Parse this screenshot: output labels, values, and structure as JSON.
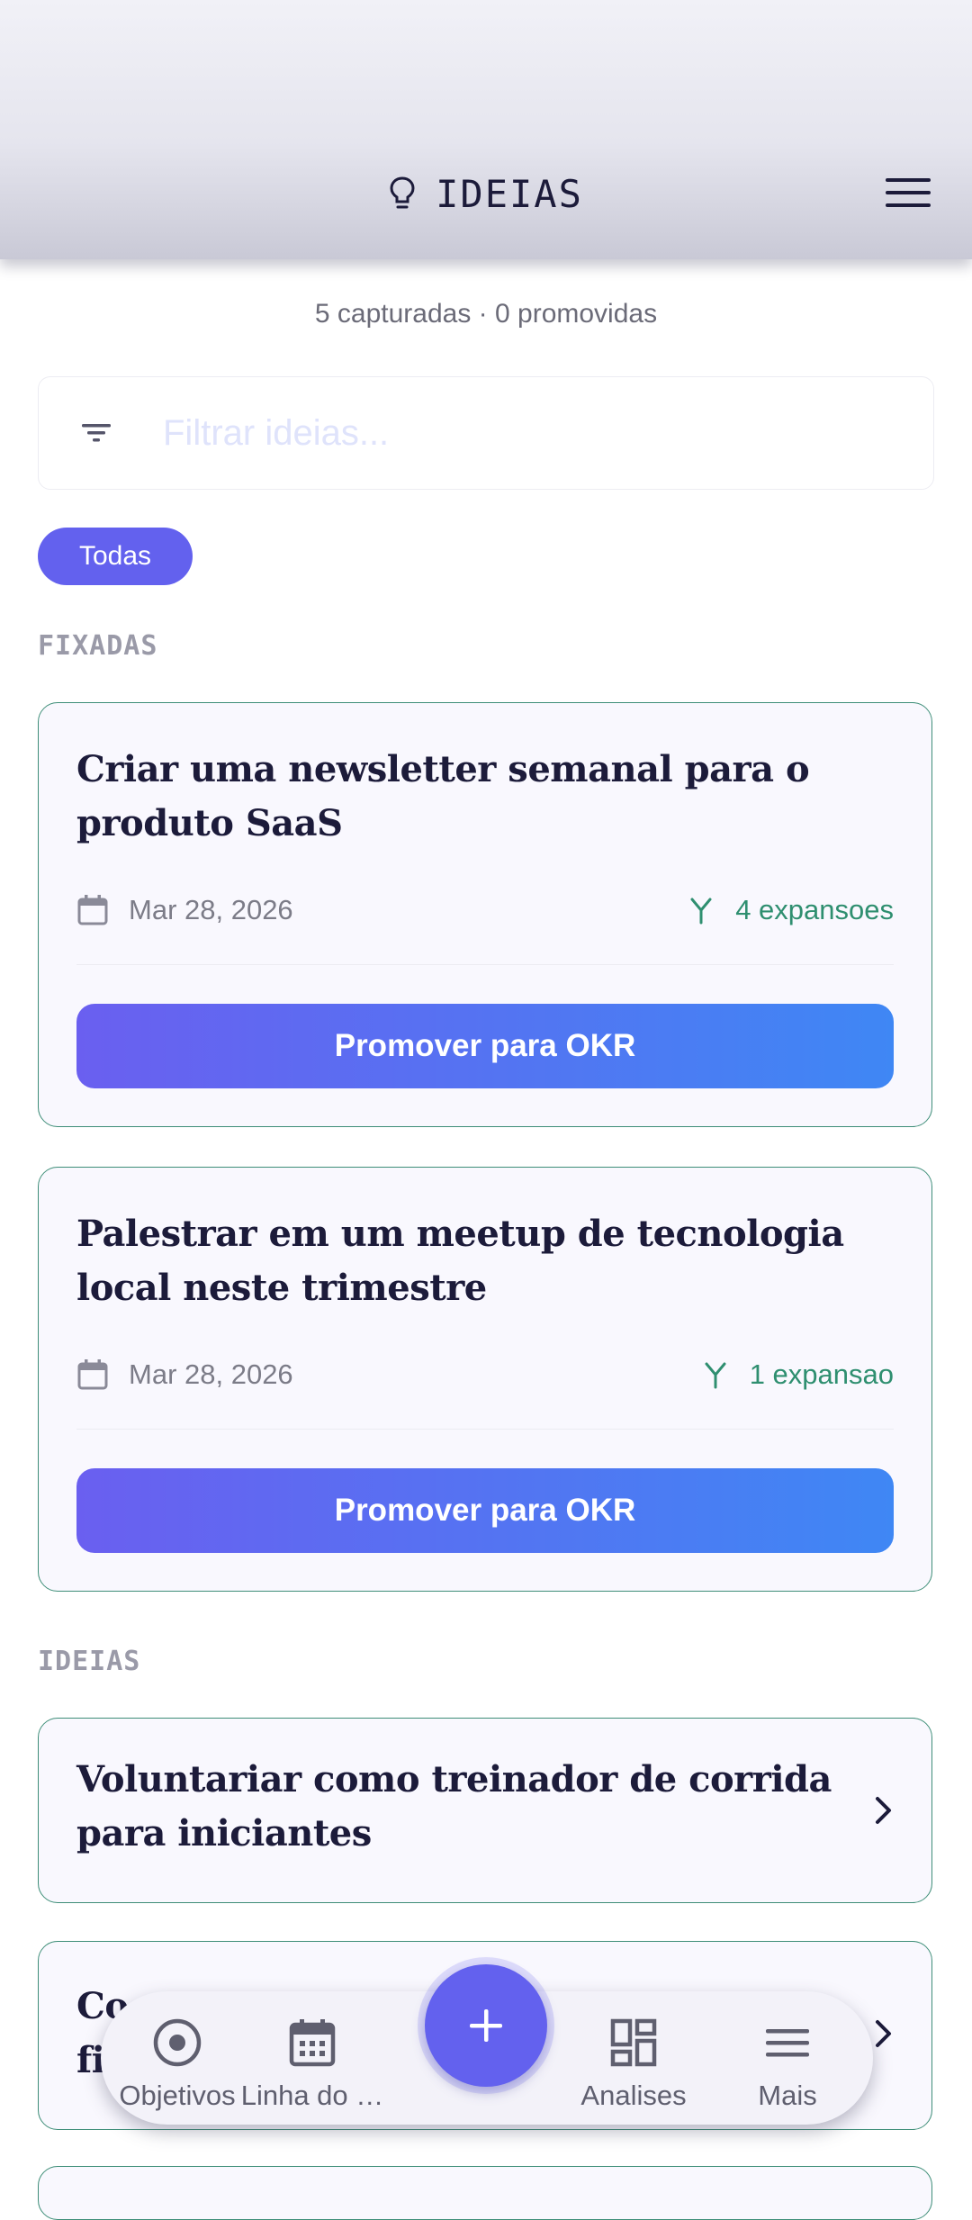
{
  "header": {
    "title": "IDEIAS",
    "icon": "lightbulb-icon",
    "menu_icon": "hamburger-icon"
  },
  "summary": "5 capturadas · 0 promovidas",
  "filter": {
    "placeholder": "Filtrar ideias..."
  },
  "chips": [
    {
      "label": "Todas",
      "selected": true
    }
  ],
  "sections": {
    "pinned": {
      "label": "FIXADAS",
      "cards": [
        {
          "title": "Criar uma newsletter semanal para o produto SaaS",
          "date": "Mar 28, 2026",
          "expansions": "4 expansoes",
          "action": "Promover para OKR"
        },
        {
          "title": "Palestrar em um meetup de tecnologia local neste trimestre",
          "date": "Mar 28, 2026",
          "expansions": "1 expansao",
          "action": "Promover para OKR"
        }
      ]
    },
    "ideas": {
      "label": "IDEIAS",
      "items": [
        {
          "title": "Voluntariar como treinador de corrida para iniciantes"
        },
        {
          "title": "Co fi"
        }
      ]
    }
  },
  "bottom_nav": {
    "items": [
      {
        "label": "Objetivos",
        "icon": "target-icon"
      },
      {
        "label": "Linha do …",
        "icon": "calendar-icon"
      },
      {
        "label": "Analises",
        "icon": "dashboard-icon"
      },
      {
        "label": "Mais",
        "icon": "menu-icon"
      }
    ],
    "fab": {
      "icon": "plus-icon"
    }
  },
  "colors": {
    "accent": "#6361ee",
    "accent_end": "#3f87f4",
    "green": "#2f8f70",
    "ink": "#1c1b3a"
  }
}
